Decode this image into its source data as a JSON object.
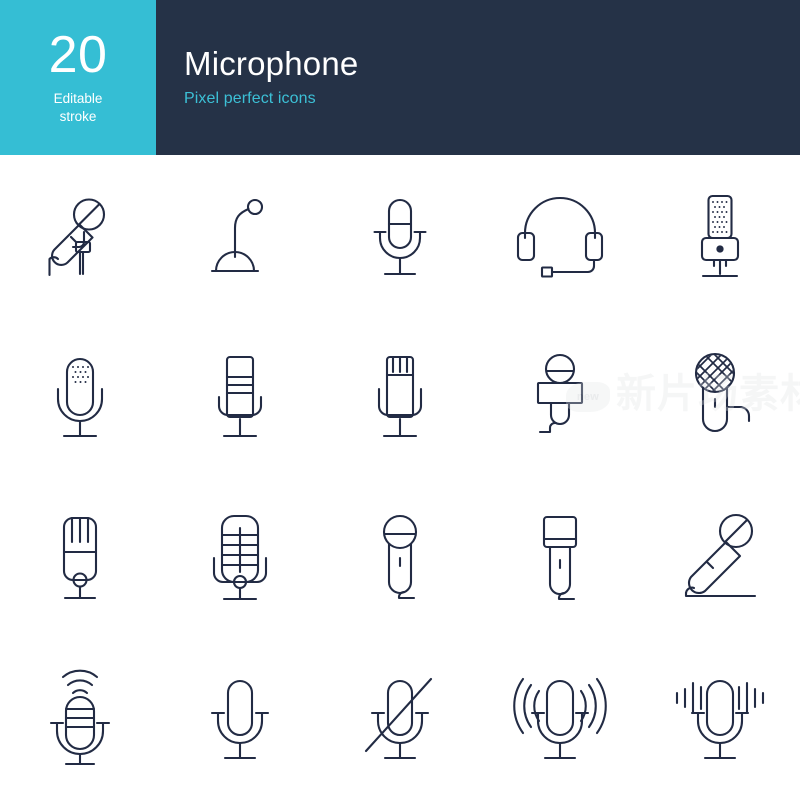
{
  "header": {
    "badge": {
      "count": "20",
      "subtitle_line1": "Editable",
      "subtitle_line2": "stroke",
      "background_color": "#35bed4",
      "text_color": "#ffffff"
    },
    "title": "Microphone",
    "subtitle": "Pixel perfect icons",
    "background_color": "#253247",
    "title_color": "#ffffff",
    "subtitle_color": "#3cc0d6"
  },
  "grid": {
    "columns": 5,
    "rows": 4,
    "total_icons": 20,
    "stroke_color": "#222b44",
    "background_color": "#ffffff",
    "icons": [
      {
        "index": 1,
        "name": "handheld-mic-tilted-stand-icon",
        "label": "Handheld microphone on tilted stand"
      },
      {
        "index": 2,
        "name": "gooseneck-desk-mic-icon",
        "label": "Gooseneck desk microphone"
      },
      {
        "index": 3,
        "name": "capsule-mic-stand-icon",
        "label": "Capsule microphone on stand"
      },
      {
        "index": 4,
        "name": "headset-with-boom-mic-icon",
        "label": "Headset with boom microphone"
      },
      {
        "index": 5,
        "name": "vintage-condenser-mic-icon",
        "label": "Vintage condenser microphone"
      },
      {
        "index": 6,
        "name": "perforated-capsule-mic-icon",
        "label": "Perforated capsule microphone"
      },
      {
        "index": 7,
        "name": "ribbon-studio-mic-icon",
        "label": "Ribbon studio microphone"
      },
      {
        "index": 8,
        "name": "slotted-top-studio-mic-icon",
        "label": "Slotted top studio microphone"
      },
      {
        "index": 9,
        "name": "reporter-interview-mic-icon",
        "label": "Reporter interview microphone"
      },
      {
        "index": 10,
        "name": "mesh-ball-mic-with-cable-icon",
        "label": "Mesh ball microphone with cable"
      },
      {
        "index": 11,
        "name": "fin-top-broadcast-mic-icon",
        "label": "Fin top broadcast microphone"
      },
      {
        "index": 12,
        "name": "retro-grille-mic-shock-mount-icon",
        "label": "Retro grille microphone in shock mount"
      },
      {
        "index": 13,
        "name": "round-head-handheld-mic-icon",
        "label": "Round head handheld microphone"
      },
      {
        "index": 14,
        "name": "square-head-handheld-mic-icon",
        "label": "Square head handheld microphone"
      },
      {
        "index": 15,
        "name": "diagonal-handheld-mic-cable-icon",
        "label": "Diagonal handheld microphone with cable"
      },
      {
        "index": 16,
        "name": "mic-broadcasting-signal-icon",
        "label": "Microphone broadcasting signal"
      },
      {
        "index": 17,
        "name": "simple-mic-icon",
        "label": "Simple microphone"
      },
      {
        "index": 18,
        "name": "mic-muted-icon",
        "label": "Microphone muted"
      },
      {
        "index": 19,
        "name": "mic-listening-waves-icon",
        "label": "Microphone with listening waves"
      },
      {
        "index": 20,
        "name": "mic-audio-levels-icon",
        "label": "Microphone with audio level bars"
      }
    ]
  },
  "watermark": {
    "badge_text": "new",
    "text": "新片场素材"
  }
}
